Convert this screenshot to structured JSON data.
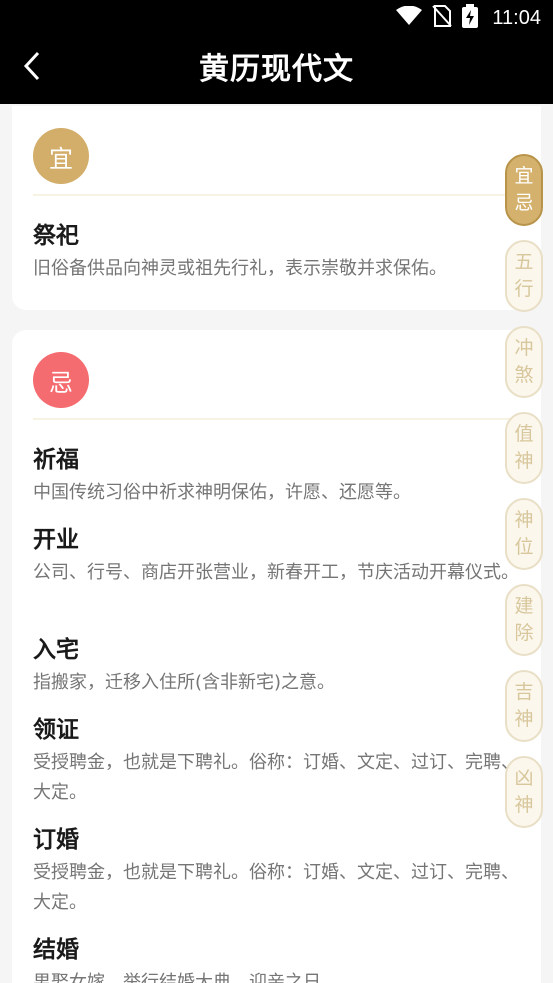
{
  "status": {
    "time": "11:04",
    "icons": [
      "wifi-icon",
      "no-sim-icon",
      "battery-charging-icon"
    ]
  },
  "header": {
    "title": "黄历现代文",
    "back_icon": "chevron-left-icon"
  },
  "yi": {
    "badge": "宜",
    "items": [
      {
        "name": "祭祀",
        "desc": "旧俗备供品向神灵或祖先行礼，表示崇敬并求保佑。"
      }
    ]
  },
  "ji": {
    "badge": "忌",
    "items": [
      {
        "name": "祈福",
        "desc": "中国传统习俗中祈求神明保佑，许愿、还愿等。"
      },
      {
        "name": "开业",
        "desc": "公司、行号、商店开张营业，新春开工，节庆活动开幕仪式。"
      },
      {
        "name": "入宅",
        "desc": "指搬家，迁移入住所(含非新宅)之意。"
      },
      {
        "name": "领证",
        "desc": "受授聘金，也就是下聘礼。俗称：订婚、文定、过订、完聘、大定。"
      },
      {
        "name": "订婚",
        "desc": "受授聘金，也就是下聘礼。俗称：订婚、文定、过订、完聘、大定。"
      },
      {
        "name": "结婚",
        "desc": "男娶女嫁，举行结婚大典，迎亲之日。"
      }
    ]
  },
  "side_nav": [
    {
      "top": "宜",
      "bottom": "忌",
      "active": true
    },
    {
      "top": "五",
      "bottom": "行",
      "active": false
    },
    {
      "top": "冲",
      "bottom": "煞",
      "active": false
    },
    {
      "top": "值",
      "bottom": "神",
      "active": false
    },
    {
      "top": "神",
      "bottom": "位",
      "active": false
    },
    {
      "top": "建",
      "bottom": "除",
      "active": false
    },
    {
      "top": "吉",
      "bottom": "神",
      "active": false
    },
    {
      "top": "凶",
      "bottom": "神",
      "active": false
    }
  ],
  "colors": {
    "yi_badge": "#d3ad6a",
    "ji_badge": "#f56c70",
    "nav_active": "#d4b26e",
    "nav_inactive_text": "#d8c79c"
  }
}
